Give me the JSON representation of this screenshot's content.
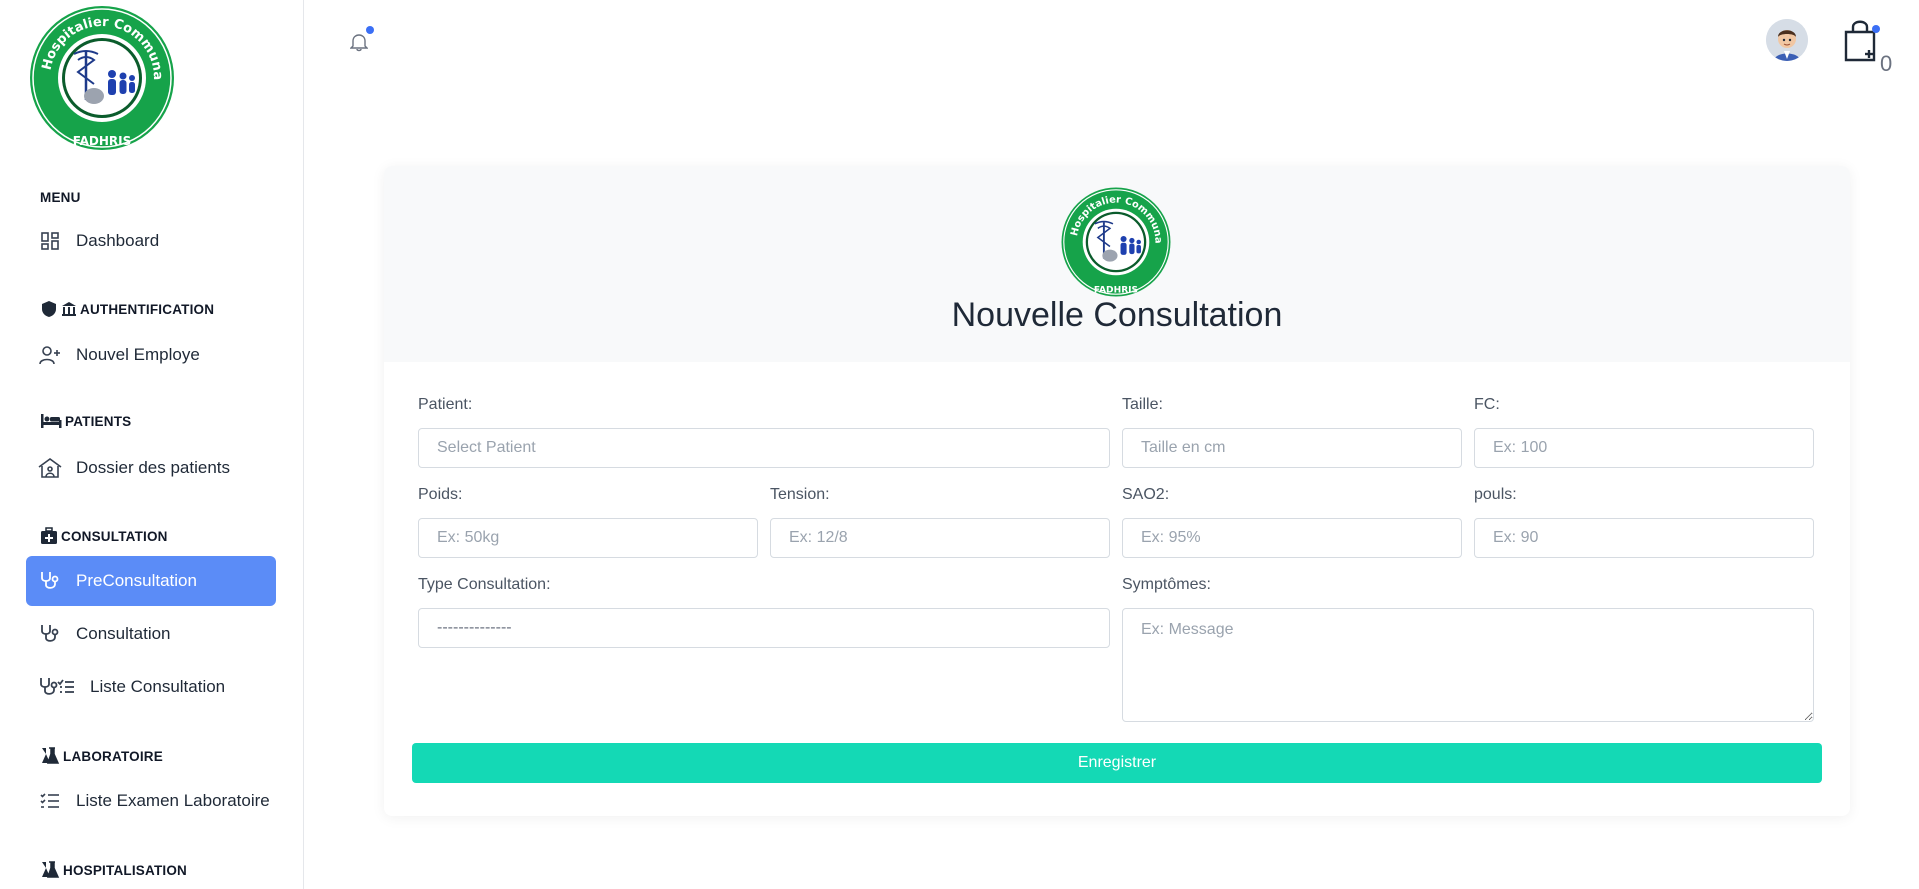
{
  "app": {
    "logo_alt": "Centre Hospitalier Communautaire FADHRIS"
  },
  "logo": {
    "text_top": "Centre Hospitalier Communautaire",
    "text_bottom": "FADHRIS"
  },
  "colors": {
    "accent": "#5b8cf7",
    "save": "#14d9b5",
    "logo_green": "#16a34a",
    "notif_dot": "#3b6ff5"
  },
  "sidebar": {
    "menu_title": "MENU",
    "dashboard": "Dashboard",
    "auth_title": "AUTHENTIFICATION",
    "new_employee": "Nouvel Employe",
    "patients_title": "PATIENTS",
    "patient_records": "Dossier des patients",
    "consultation_title": "CONSULTATION",
    "preconsultation": "PreConsultation",
    "consultation": "Consultation",
    "consultation_list": "Liste Consultation",
    "lab_title": "LABORATOIRE",
    "lab_list": "Liste Examen Laboratoire",
    "hosp_title": "HOSPITALISATION"
  },
  "topbar": {
    "cart_count": "0"
  },
  "form": {
    "title": "Nouvelle Consultation",
    "patient_label": "Patient:",
    "patient_placeholder": "Select Patient",
    "height_label": "Taille:",
    "height_placeholder": "Taille en cm",
    "fc_label": "FC:",
    "fc_placeholder": "Ex: 100",
    "weight_label": "Poids:",
    "weight_placeholder": "Ex: 50kg",
    "tension_label": "Tension:",
    "tension_placeholder": "Ex: 12/8",
    "sao2_label": "SAO2:",
    "sao2_placeholder": "Ex: 95%",
    "pulse_label": "pouls:",
    "pulse_placeholder": "Ex: 90",
    "type_label": "Type Consultation:",
    "type_value": "--------------",
    "symptoms_label": "Symptômes:",
    "symptoms_placeholder": "Ex: Message",
    "save_label": "Enregistrer"
  }
}
